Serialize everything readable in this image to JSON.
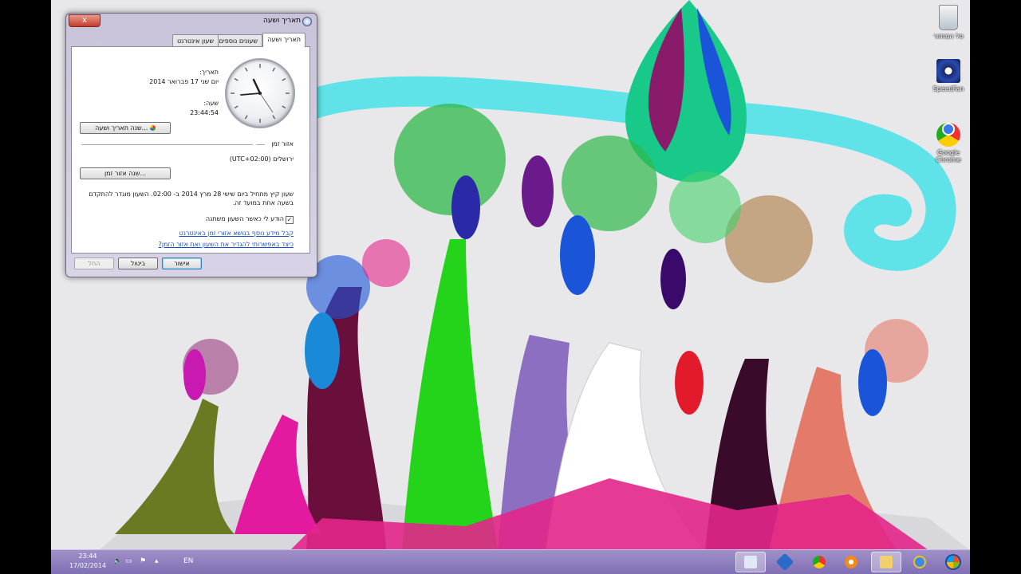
{
  "desktop": {
    "icons": [
      {
        "label": "סל המחזור",
        "icon": "recycle-bin-icon"
      },
      {
        "label": "SpeedFan",
        "icon": "speedfan-icon"
      },
      {
        "label": "Google Chrome",
        "icon": "chrome-icon"
      }
    ]
  },
  "dialog": {
    "title": "תאריך ושעה",
    "close_label": "x",
    "tabs": [
      {
        "label": "תאריך ושעה"
      },
      {
        "label": "שעונים נוספים"
      },
      {
        "label": "שעון אינטרנט"
      }
    ],
    "date_label": "תאריך:",
    "date_value": "יום שני 17 פברואר 2014",
    "time_label": "שעה:",
    "time_value": "23:44:54",
    "change_date_button": "שנה תאריך ושעה...",
    "timezone_label": "אזור זמן",
    "timezone_value": "(UTC+02:00) ירושלים",
    "change_timezone_button": "שנה אזור זמן...",
    "dst_notice": "שעון קיץ מתחיל ביום שישי 28 מרץ 2014 ב- 02:00. השעון מוגדר להתקדם בשעה אחת במועד זה.",
    "notify_checkbox_label": "הודע לי כאשר השעון משתנה",
    "notify_checked": true,
    "link_more_info": "קבל מידע נוסף בנושא אזורי זמן באינטרנט",
    "link_how_to": "כיצד באפשרותי להגדיר את השעון ואת אזור הזמן?",
    "ok_button": "אישור",
    "cancel_button": "ביטול",
    "apply_button": "החל"
  },
  "taskbar": {
    "clock_time": "23:44",
    "clock_date": "17/02/2014",
    "language": "EN",
    "pinned": [
      "windows-start-icon",
      "internet-explorer-icon",
      "file-explorer-icon",
      "media-player-icon",
      "chrome-icon",
      "virtualbox-icon",
      "date-time-dialog-icon"
    ]
  },
  "colors": {
    "taskbar": "#8a7abd",
    "link": "#1a52c6",
    "close_button": "#c43c2c"
  }
}
